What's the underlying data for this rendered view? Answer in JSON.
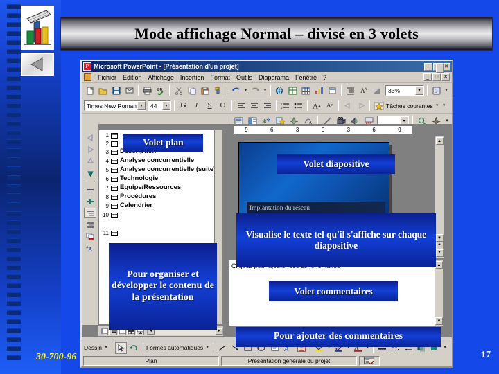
{
  "banner": {
    "title": "Mode affichage Normal – divisé en 3 volets"
  },
  "footer": {
    "code": "30-700-96",
    "page_number": "17"
  },
  "logos": {
    "chart_logo": "chart-logo-icon",
    "back_button": "back-arrow-icon"
  },
  "ppt_window": {
    "title": "Microsoft PowerPoint - [Présentation d'un projet]",
    "app_icon": "powerpoint-icon",
    "window_buttons": [
      "_",
      "□",
      "✕"
    ],
    "doc_window_buttons": [
      "_",
      "□",
      "✕"
    ],
    "menu": [
      "Fichier",
      "Edition",
      "Affichage",
      "Insertion",
      "Format",
      "Outils",
      "Diaporama",
      "Fenêtre",
      "?"
    ],
    "standard_toolbar": {
      "zoom_value": "33%",
      "buttons": [
        "new-document-icon",
        "open-folder-icon",
        "save-disk-icon",
        "mail-icon",
        "print-icon",
        "spellcheck-icon",
        "cut-scissors-icon",
        "copy-icon",
        "paste-icon",
        "format-painter-icon",
        "undo-icon",
        "redo-icon",
        "insert-hyperlink-icon",
        "tables-and-borders-icon",
        "insert-table-icon",
        "insert-chart-icon",
        "new-slide-icon",
        "expand-all-icon",
        "show-formatting-icon",
        "grayscale-icon",
        "help-icon"
      ]
    },
    "formatting_toolbar": {
      "font_name": "Times New Roman",
      "font_size": "44",
      "bold_label": "G",
      "italic_label": "I",
      "underline_label": "S",
      "shadow_label": "O",
      "task_pane_label": "Tâches courantes",
      "buttons": [
        "align-left-icon",
        "align-center-icon",
        "align-right-icon",
        "numbered-list-icon",
        "bulleted-list-icon",
        "increase-font-icon",
        "decrease-font-icon",
        "promote-icon",
        "demote-icon",
        "common-tasks-star-icon"
      ]
    },
    "extra_toolbar": {
      "combo_value": "",
      "buttons": [
        "slide-layout-icon",
        "slide-design-icon",
        "animation-scheme-icon",
        "custom-animation-star-icon",
        "animation-preview-icon",
        "wordart-icon",
        "pen-icon",
        "movie-icon",
        "sound-icon",
        "spell-abc-icon",
        "research-icon",
        "hide-icon"
      ]
    },
    "outline_pane": {
      "scroll_tool_icons": [
        "promote-left-icon",
        "demote-right-icon",
        "move-up-icon",
        "move-down-icon",
        "collapse-icon",
        "expand-icon",
        "collapse-all-icon",
        "expand-all-icon",
        "summary-slide-icon",
        "show-formatting-icon"
      ],
      "items": [
        {
          "num": "1",
          "text": ""
        },
        {
          "num": "2",
          "text": ""
        },
        {
          "num": "3",
          "text": "Description"
        },
        {
          "num": "4",
          "text": "Analyse concurrentielle"
        },
        {
          "num": "5",
          "text": "Analyse concurrentielle (suite)"
        },
        {
          "num": "6",
          "text": "Technologie"
        },
        {
          "num": "7",
          "text": "Équipe/Ressources"
        },
        {
          "num": "8",
          "text": "Procédures"
        },
        {
          "num": "9",
          "text": "Calendrier"
        },
        {
          "num": "10",
          "text": ""
        },
        {
          "num": "11",
          "text": ""
        }
      ],
      "view_buttons": [
        "normal-view-icon",
        "outline-view-icon",
        "slide-view-icon",
        "slide-sorter-icon",
        "slide-show-icon"
      ]
    },
    "ruler": {
      "ticks": [
        "9",
        "6",
        "3",
        "0",
        "3",
        "6",
        "9"
      ]
    },
    "slide_pane": {
      "subtitle_text": "Implantation du réseau"
    },
    "notes_pane": {
      "placeholder": "Cliquez pour ajouter des commentaires"
    },
    "drawing_toolbar": {
      "draw_label": "Dessin",
      "autoshapes_label": "Formes automatiques",
      "buttons": [
        "select-arrow-icon",
        "rotate-icon",
        "line-icon",
        "arrow-icon",
        "rectangle-icon",
        "ellipse-icon",
        "textbox-icon",
        "wordart-icon",
        "insert-clipart-icon",
        "fill-color-icon",
        "line-color-icon",
        "font-color-icon",
        "line-style-icon",
        "dash-style-icon",
        "arrow-style-icon",
        "shadow-icon",
        "3d-icon"
      ]
    },
    "status_bar": {
      "left_cell": "Plan",
      "center_cell": "Présentation générale du projet",
      "right_cell_icon": "spellcheck-status-icon"
    }
  },
  "callouts": {
    "volet_plan": "Volet plan",
    "pour_organiser": "Pour organiser et développer le contenu de la présentation",
    "volet_diapositive": "Volet diapositive",
    "visualise": "Visualise le texte tel qu'il s'affiche sur chaque diapositive",
    "volet_commentaires": "Volet commentaires",
    "pour_ajouter": "Pour ajouter des commentaires"
  },
  "colors": {
    "slide_background": "#1548e8",
    "callout_blue": "#1340d8",
    "footer_yellow": "#f5ef3a",
    "titlebar_blue": "#0a246a",
    "window_face": "#d4d0c8"
  }
}
